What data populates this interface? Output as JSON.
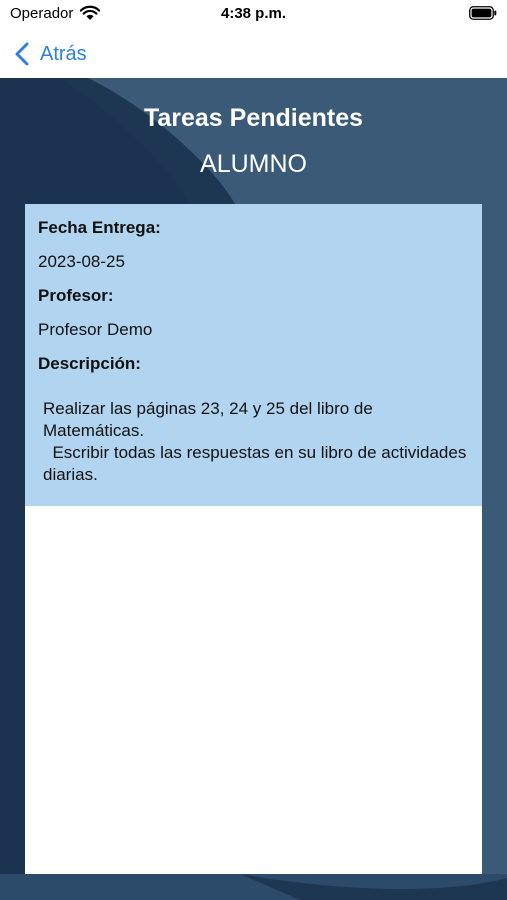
{
  "status_bar": {
    "carrier": "Operador",
    "time": "4:38 p.m.",
    "wifi_icon": "wifi-icon",
    "battery_icon": "battery-icon"
  },
  "nav": {
    "back_label": "Atrás",
    "back_icon": "chevron-left-icon",
    "accent_color": "#2f7fdc"
  },
  "header": {
    "title": "Tareas Pendientes",
    "subtitle": "ALUMNO"
  },
  "task": {
    "due_label": "Fecha Entrega:",
    "due_value": "2023-08-25",
    "teacher_label": "Profesor:",
    "teacher_value": "Profesor Demo",
    "description_label": "Descripción:",
    "description_text": "Realizar las páginas 23, 24 y 25 del libro de Matemáticas.\n  Escribir todas las respuestas en su libro de actividades diarias."
  },
  "colors": {
    "background_dark": "#1d3652",
    "background_light": "#3b5a78",
    "card_info": "#b1d5f0"
  }
}
